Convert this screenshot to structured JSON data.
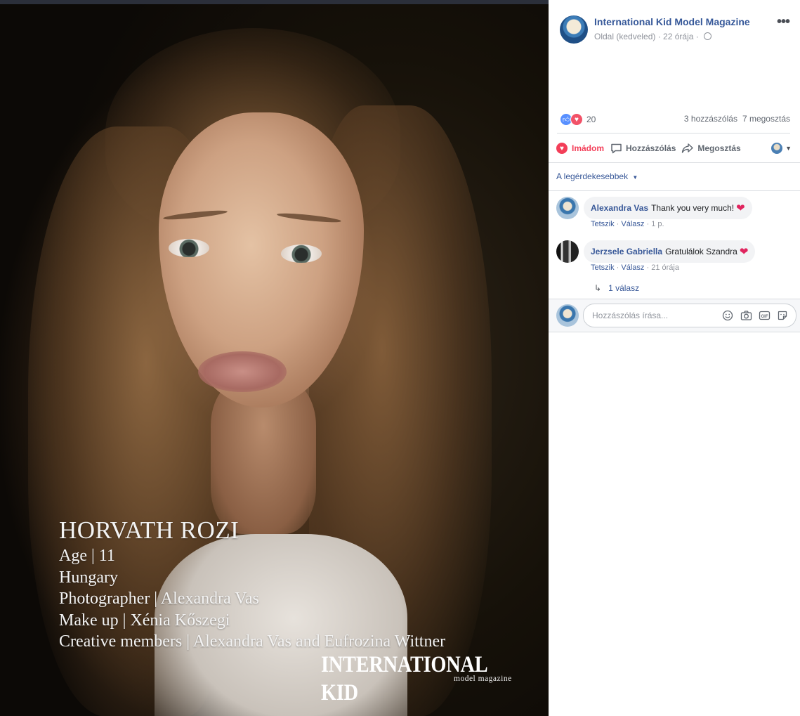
{
  "photo": {
    "caption": {
      "name": "HORVATH ROZI",
      "lines": [
        "Age | 11",
        "Hungary",
        "Photographer |  Alexandra Vas",
        "Make up | Xénia Kőszegi",
        "Creative members | Alexandra Vas and Eufrozina Wittner"
      ]
    },
    "brand": "INTERNATIONAL KID",
    "brand_sub": "model magazine"
  },
  "post": {
    "page_name": "International Kid Model Magazine",
    "meta": "Oldal (kedveled) · 22 órája ·",
    "reaction_count": "20",
    "comments_count": "3 hozzászólás",
    "shares_count": "7 megosztás"
  },
  "actions": {
    "love": "Imádom",
    "comment": "Hozzászólás",
    "share": "Megosztás"
  },
  "sort_label": "A legérdekesebbek",
  "comments": [
    {
      "author": "Alexandra Vas",
      "text": "Thank you very much!",
      "like": "Tetszik",
      "reply": "Válasz",
      "time": "1 p."
    },
    {
      "author": "Jerzsele Gabriella",
      "text": "Gratulálok Szandra",
      "like": "Tetszik",
      "reply": "Válasz",
      "time": "21 órája"
    }
  ],
  "replies_link": "1 válasz",
  "composer": {
    "placeholder": "Hozzászólás írása..."
  },
  "colors": {
    "link": "#385898",
    "love": "#f33e58",
    "like_blue": "#5890ff"
  }
}
